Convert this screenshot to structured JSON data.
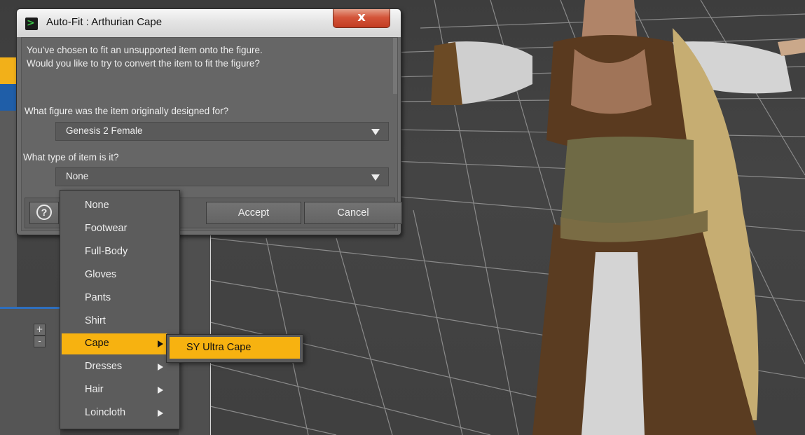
{
  "dialog": {
    "title": "Auto-Fit : Arthurian Cape",
    "close_label": "x",
    "message_line1": "You've chosen to fit an unsupported item onto the figure.",
    "message_line2": "Would you like to try to convert the item to fit the figure?",
    "figure_question": "What figure was the item originally designed for?",
    "figure_value": "Genesis 2 Female",
    "type_question": "What type of item is it?",
    "type_value": "None",
    "help_icon_label": "?",
    "accept_label": "Accept",
    "cancel_label": "Cancel"
  },
  "type_menu": {
    "items": [
      {
        "label": "None",
        "submenu": false
      },
      {
        "label": "Footwear",
        "submenu": false
      },
      {
        "label": "Full-Body",
        "submenu": false
      },
      {
        "label": "Gloves",
        "submenu": false
      },
      {
        "label": "Pants",
        "submenu": false
      },
      {
        "label": "Shirt",
        "submenu": false
      },
      {
        "label": "Cape",
        "submenu": true,
        "selected": true
      },
      {
        "label": "Dresses",
        "submenu": true
      },
      {
        "label": "Hair",
        "submenu": true
      },
      {
        "label": "Loincloth",
        "submenu": true
      }
    ],
    "highlight_color": "#f7b210"
  },
  "submenu": {
    "items": [
      {
        "label": "SY Ultra Cape"
      }
    ]
  },
  "sidebar": {
    "plus_label": "+",
    "minus_label": "-"
  },
  "colors": {
    "accent": "#f7b210",
    "app_blue": "#1f5ea8",
    "close_red": "#c8442a"
  }
}
